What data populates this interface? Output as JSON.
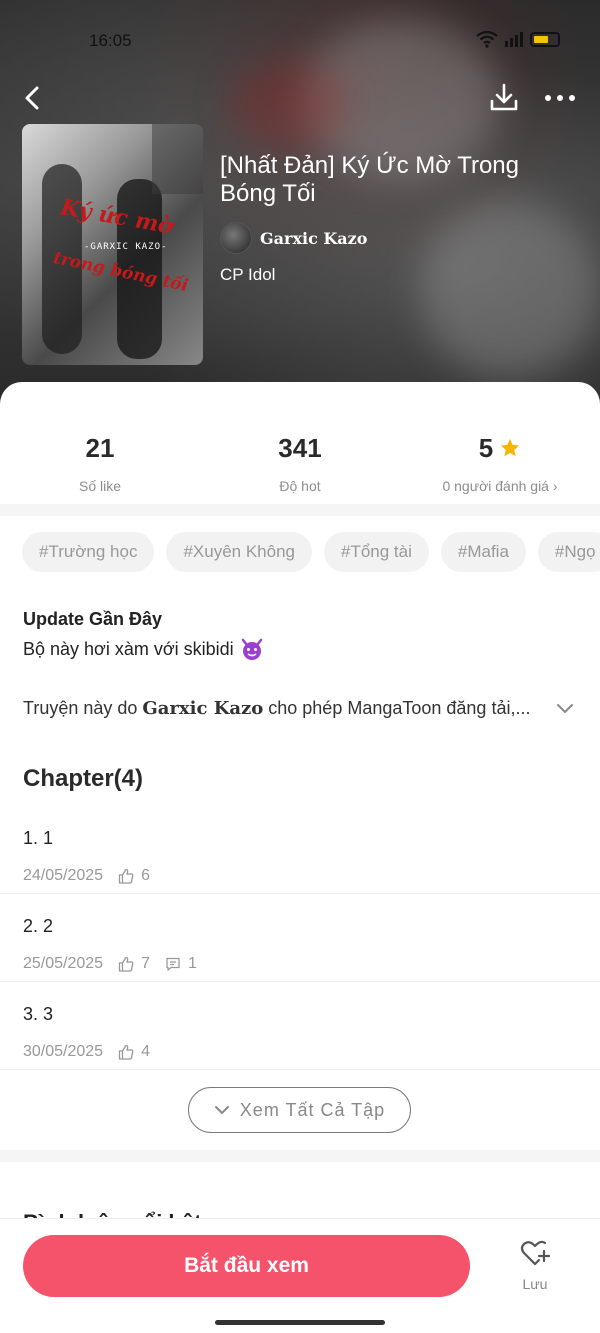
{
  "status_bar": {
    "time": "16:05"
  },
  "book": {
    "title": "[Nhất Đản] Ký Ức Mờ Trong Bóng Tối",
    "author": "Garxic Kazo",
    "genre": "CP Idol",
    "cover_text_1": "Ký ức mờ",
    "cover_text_2": "trong bóng tối",
    "cover_author": "-GARXIC KAZO-"
  },
  "stats": [
    {
      "value": "21",
      "label": "Số like"
    },
    {
      "value": "341",
      "label": "Độ hot"
    },
    {
      "value": "5",
      "label": "0 người đánh giá ›"
    }
  ],
  "tags": [
    "#Trường học",
    "#Xuyên Không",
    "#Tổng tài",
    "#Mafia",
    "#Ngọ"
  ],
  "update": {
    "heading": "Update Gần Đây",
    "text": "Bộ này hơi xàm với skibidi"
  },
  "permission": {
    "prefix": "Truyện này do",
    "author": "Garxic Kazo",
    "suffix": "cho phép MangaToon đăng tải,..."
  },
  "chapters_heading": "Chapter(4)",
  "chapters": [
    {
      "title": "1. 1",
      "date": "24/05/2025",
      "likes": "6",
      "comments": ""
    },
    {
      "title": "2. 2",
      "date": "25/05/2025",
      "likes": "7",
      "comments": "1"
    },
    {
      "title": "3. 3",
      "date": "30/05/2025",
      "likes": "4",
      "comments": ""
    }
  ],
  "see_all_label": "Xem Tất Cả Tập",
  "partial_heading": "Bình luận nổi bật",
  "bottom": {
    "start_label": "Bắt đầu xem",
    "save_label": "Lưu"
  },
  "colors": {
    "accent": "#f5536b",
    "star": "#f7b500",
    "devil": "#9b3fd1"
  },
  "icons": [
    "back-icon",
    "download-icon",
    "more-icon",
    "star-icon",
    "devil-icon",
    "chevron-down-icon",
    "thumb-up-icon",
    "comment-icon",
    "heart-plus-icon"
  ]
}
